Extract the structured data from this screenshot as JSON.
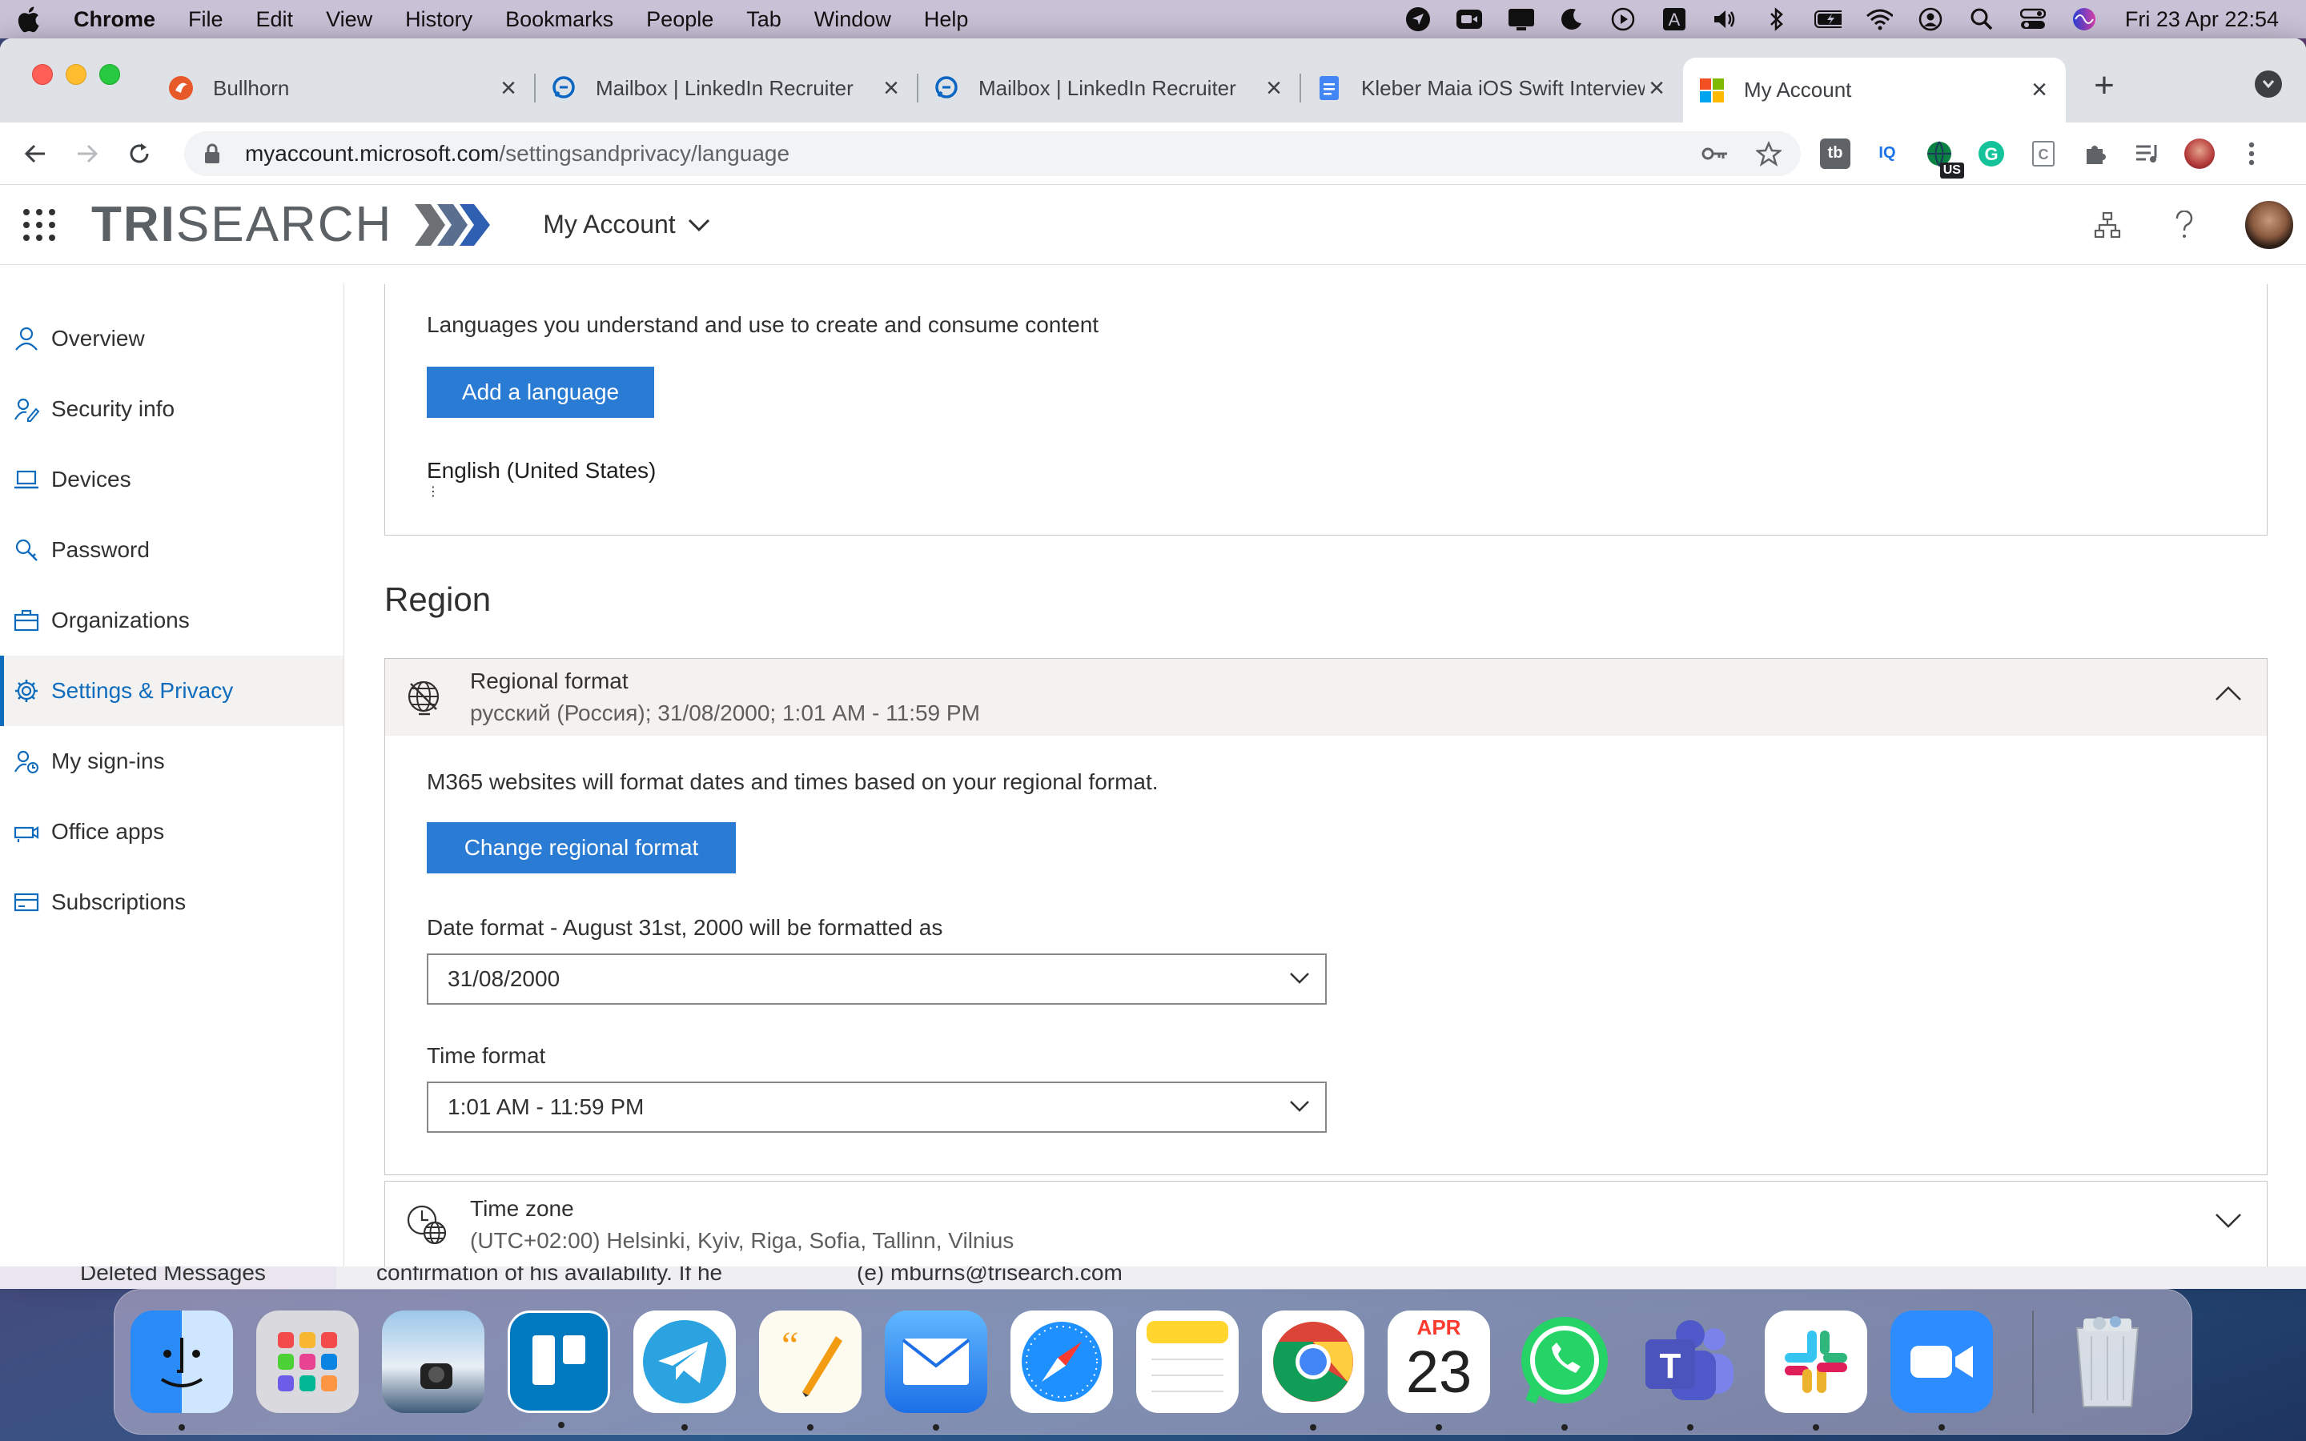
{
  "menubar": {
    "app_name": "Chrome",
    "menus": [
      "File",
      "Edit",
      "View",
      "History",
      "Bookmarks",
      "People",
      "Tab",
      "Window",
      "Help"
    ],
    "clock": "Fri 23 Apr  22:54"
  },
  "browser": {
    "tabs": [
      {
        "title": "Bullhorn",
        "icon": "bullhorn-icon"
      },
      {
        "title": "Mailbox | LinkedIn Recruiter",
        "icon": "linkedin-mailbox-icon"
      },
      {
        "title": "Mailbox | LinkedIn Recruiter",
        "icon": "linkedin-mailbox-icon"
      },
      {
        "title": "Kleber Maia iOS Swift Interview",
        "icon": "google-docs-icon"
      },
      {
        "title": "My Account",
        "icon": "microsoft-icon"
      }
    ],
    "new_tab_label": "+",
    "url_host": "myaccount.microsoft.com",
    "url_path": "/settingsandprivacy/language",
    "ext_badge": "US"
  },
  "header": {
    "brand_bold": "TRI",
    "brand_rest": "SEARCH",
    "app_title": "My Account"
  },
  "sidebar": {
    "items": [
      {
        "label": "Overview",
        "icon": "person-icon"
      },
      {
        "label": "Security info",
        "icon": "security-info-icon"
      },
      {
        "label": "Devices",
        "icon": "laptop-icon"
      },
      {
        "label": "Password",
        "icon": "key-icon"
      },
      {
        "label": "Organizations",
        "icon": "briefcase-icon"
      },
      {
        "label": "Settings & Privacy",
        "icon": "gear-icon"
      },
      {
        "label": "My sign-ins",
        "icon": "sign-ins-icon"
      },
      {
        "label": "Office apps",
        "icon": "office-apps-icon"
      },
      {
        "label": "Subscriptions",
        "icon": "card-icon"
      }
    ],
    "active_index": 5
  },
  "language": {
    "description": "Languages you understand and use to create and consume content",
    "add_button": "Add a language",
    "current_language": "English (United States)",
    "more_label": "⋮"
  },
  "region": {
    "section_title": "Region",
    "regional_format": {
      "title": "Regional format",
      "value": "русский (Россия); 31/08/2000; 1:01 AM - 11:59 PM",
      "description": "M365 websites will format dates and times based on your regional format.",
      "change_button": "Change regional format",
      "date_label": "Date format - August 31st, 2000 will be formatted as",
      "date_value": "31/08/2000",
      "time_label": "Time format",
      "time_value": "1:01 AM - 11:59 PM"
    },
    "time_zone": {
      "title": "Time zone",
      "value": "(UTC+02:00) Helsinki, Kyiv, Riga, Sofia, Tallinn, Vilnius"
    }
  },
  "behind_window": {
    "text1": "Deleted Messages",
    "text2": "confirmation of his availability. If he",
    "text3": "(e) mburns@trisearch.com"
  },
  "dock": {
    "apps": [
      "Finder",
      "Launchpad",
      "Preview",
      "Trello",
      "Telegram",
      "Pages",
      "Mail",
      "Safari",
      "Notes",
      "Chrome",
      "Calendar",
      "WhatsApp",
      "Teams",
      "Slack",
      "Zoom"
    ],
    "calendar_month": "APR",
    "calendar_day": "23"
  },
  "colors": {
    "accent": "#0f6cbd",
    "button": "#2a7bd3"
  }
}
